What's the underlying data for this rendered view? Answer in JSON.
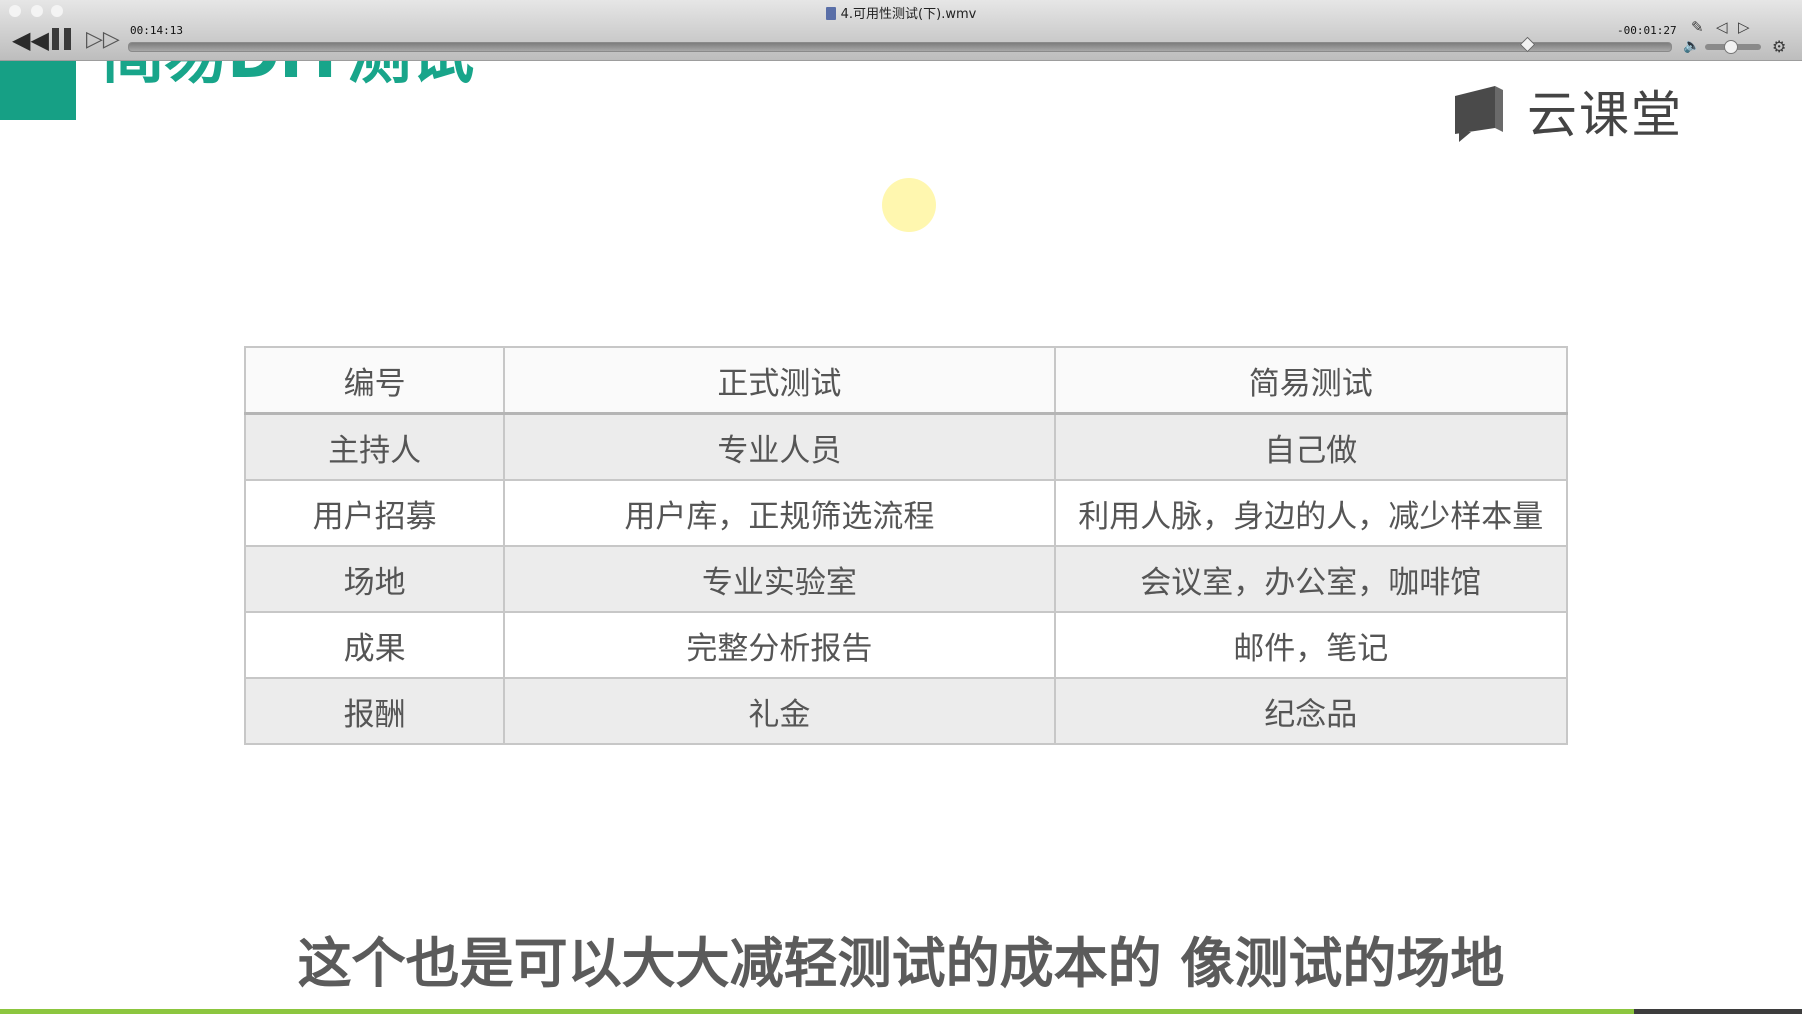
{
  "player": {
    "file_title": "4.可用性测试(下).wmv",
    "time_elapsed": "00:14:13",
    "time_remaining": "-00:01:27",
    "progress_fraction": 0.907,
    "volume_fraction": 0.45,
    "icons": {
      "rewind": "rewind-icon",
      "pause": "pause-icon",
      "forward": "fast-forward-icon",
      "edit": "edit-icon",
      "prev": "previous-icon",
      "next": "next-icon",
      "volume": "volume-icon",
      "settings": "settings-icon"
    }
  },
  "slide": {
    "title": "简易DIY测试",
    "logo_text": "云课堂",
    "accent_color": "#18a58a",
    "table": {
      "headers": [
        "编号",
        "正式测试",
        "简易测试"
      ],
      "rows": [
        [
          "主持人",
          "专业人员",
          "自己做"
        ],
        [
          "用户招募",
          "用户库，正规筛选流程",
          "利用人脉，身边的人，减少样本量"
        ],
        [
          "场地",
          "专业实验室",
          "会议室，办公室，咖啡馆"
        ],
        [
          "成果",
          "完整分析报告",
          "邮件，笔记"
        ],
        [
          "报酬",
          "礼金",
          "纪念品"
        ]
      ]
    }
  },
  "subtitle": "这个也是可以大大减轻测试的成本的 像测试的场地",
  "bottom_progress_fraction": 0.907,
  "colors": {
    "progress_green": "#8cc63f",
    "brand_green": "#16a085"
  }
}
